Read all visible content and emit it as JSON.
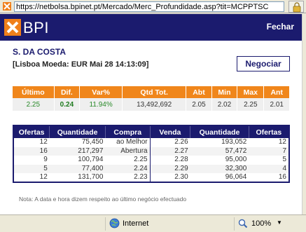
{
  "browser": {
    "url": "https://netbolsa.bpinet.pt/Mercado/Merc_Profundidade.asp?tit=MCPPTSC",
    "status_zone": "Internet",
    "zoom": "100%"
  },
  "header": {
    "logo_text": "BPI",
    "close_label": "Fechar"
  },
  "stock": {
    "name": "S. DA COSTA",
    "info": "[Lisboa   Moeda: EUR   Mai 28 14:13:09]",
    "trade_button": "Negociar"
  },
  "quote": {
    "columns": [
      "Último",
      "Dif.",
      "Var%",
      "Qtd Tot.",
      "Abt",
      "Min",
      "Max",
      "Ant"
    ],
    "values": [
      "2.25",
      "0.24",
      "11.94%",
      "13,492,692",
      "2.05",
      "2.02",
      "2.25",
      "2.01"
    ]
  },
  "depth": {
    "columns": [
      "Ofertas",
      "Quantidade",
      "Compra",
      "Venda",
      "Quantidade",
      "Ofertas"
    ],
    "rows": [
      [
        "12",
        "75,450",
        "ao Melhor",
        "2.26",
        "193,052",
        "12"
      ],
      [
        "16",
        "217,297",
        "Abertura",
        "2.27",
        "57,472",
        "7"
      ],
      [
        "9",
        "100,794",
        "2.25",
        "2.28",
        "95,000",
        "5"
      ],
      [
        "5",
        "77,400",
        "2.24",
        "2.29",
        "32,300",
        "4"
      ],
      [
        "12",
        "131,700",
        "2.23",
        "2.30",
        "96,064",
        "16"
      ]
    ]
  },
  "note": "Nota: A data e hora dizem respeito ao último negócio efectuado",
  "colors": {
    "navy": "#1b1b6e",
    "orange": "#f0861b",
    "green": "#2a8a2a"
  }
}
